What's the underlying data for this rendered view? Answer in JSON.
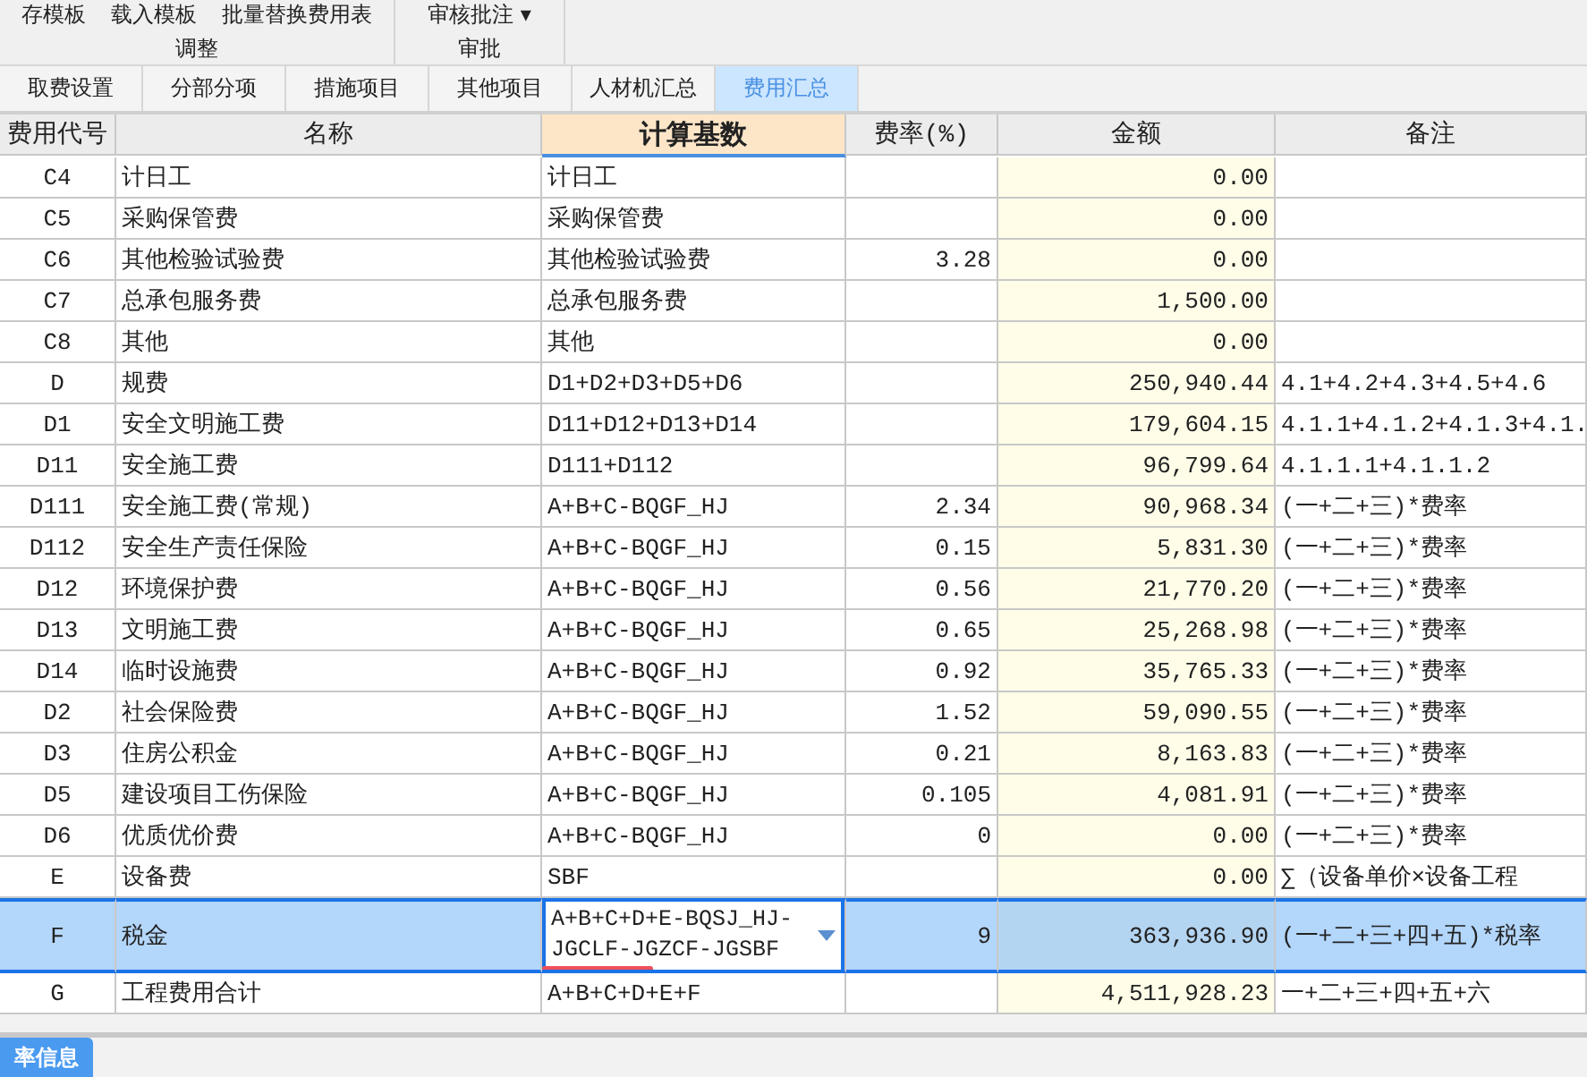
{
  "ribbon": {
    "groups": [
      {
        "label": "调整",
        "buttons": [
          "存模板",
          "载入模板",
          "批量替换费用表"
        ]
      },
      {
        "label": "审批",
        "buttons": [
          "审核批注 ▾"
        ]
      }
    ]
  },
  "tabs": [
    {
      "label": "取费设置",
      "selected": false
    },
    {
      "label": "分部分项",
      "selected": false
    },
    {
      "label": "措施项目",
      "selected": false
    },
    {
      "label": "其他项目",
      "selected": false
    },
    {
      "label": "人材机汇总",
      "selected": false
    },
    {
      "label": "费用汇总",
      "selected": true
    }
  ],
  "table": {
    "columns": [
      {
        "label": "费用代号",
        "highlighted": false
      },
      {
        "label": "名称",
        "highlighted": false
      },
      {
        "label": "计算基数",
        "highlighted": true
      },
      {
        "label": "费率(%)",
        "highlighted": false
      },
      {
        "label": "金额",
        "highlighted": false
      },
      {
        "label": "备注",
        "highlighted": false
      }
    ],
    "rows": [
      {
        "code": "C4",
        "name": "计日工",
        "base": "计日工",
        "rate": "",
        "amount": "0.00",
        "note": "",
        "selected": false
      },
      {
        "code": "C5",
        "name": "采购保管费",
        "base": "采购保管费",
        "rate": "",
        "amount": "0.00",
        "note": "",
        "selected": false
      },
      {
        "code": "C6",
        "name": "其他检验试验费",
        "base": "其他检验试验费",
        "rate": "3.28",
        "amount": "0.00",
        "note": "",
        "selected": false
      },
      {
        "code": "C7",
        "name": "总承包服务费",
        "base": "总承包服务费",
        "rate": "",
        "amount": "1,500.00",
        "note": "",
        "selected": false
      },
      {
        "code": "C8",
        "name": "其他",
        "base": "其他",
        "rate": "",
        "amount": "0.00",
        "note": "",
        "selected": false
      },
      {
        "code": "D",
        "name": "规费",
        "base": "D1+D2+D3+D5+D6",
        "rate": "",
        "amount": "250,940.44",
        "note": "4.1+4.2+4.3+4.5+4.6",
        "selected": false
      },
      {
        "code": "D1",
        "name": "安全文明施工费",
        "base": "D11+D12+D13+D14",
        "rate": "",
        "amount": "179,604.15",
        "note": "4.1.1+4.1.2+4.1.3+4.1.",
        "selected": false
      },
      {
        "code": "D11",
        "name": "安全施工费",
        "base": "D111+D112",
        "rate": "",
        "amount": "96,799.64",
        "note": "4.1.1.1+4.1.1.2",
        "selected": false
      },
      {
        "code": "D111",
        "name": "安全施工费(常规)",
        "base": "A+B+C-BQGF_HJ",
        "rate": "2.34",
        "amount": "90,968.34",
        "note": "(一+二+三)*费率",
        "selected": false
      },
      {
        "code": "D112",
        "name": "安全生产责任保险",
        "base": "A+B+C-BQGF_HJ",
        "rate": "0.15",
        "amount": "5,831.30",
        "note": "(一+二+三)*费率",
        "selected": false
      },
      {
        "code": "D12",
        "name": "环境保护费",
        "base": "A+B+C-BQGF_HJ",
        "rate": "0.56",
        "amount": "21,770.20",
        "note": "(一+二+三)*费率",
        "selected": false
      },
      {
        "code": "D13",
        "name": "文明施工费",
        "base": "A+B+C-BQGF_HJ",
        "rate": "0.65",
        "amount": "25,268.98",
        "note": "(一+二+三)*费率",
        "selected": false
      },
      {
        "code": "D14",
        "name": "临时设施费",
        "base": "A+B+C-BQGF_HJ",
        "rate": "0.92",
        "amount": "35,765.33",
        "note": "(一+二+三)*费率",
        "selected": false
      },
      {
        "code": "D2",
        "name": "社会保险费",
        "base": "A+B+C-BQGF_HJ",
        "rate": "1.52",
        "amount": "59,090.55",
        "note": "(一+二+三)*费率",
        "selected": false
      },
      {
        "code": "D3",
        "name": "住房公积金",
        "base": "A+B+C-BQGF_HJ",
        "rate": "0.21",
        "amount": "8,163.83",
        "note": "(一+二+三)*费率",
        "selected": false
      },
      {
        "code": "D5",
        "name": "建设项目工伤保险",
        "base": "A+B+C-BQGF_HJ",
        "rate": "0.105",
        "amount": "4,081.91",
        "note": "(一+二+三)*费率",
        "selected": false
      },
      {
        "code": "D6",
        "name": "优质优价费",
        "base": "A+B+C-BQGF_HJ",
        "rate": "0",
        "amount": "0.00",
        "note": "(一+二+三)*费率",
        "selected": false
      },
      {
        "code": "E",
        "name": "设备费",
        "base": "SBF",
        "rate": "",
        "amount": "0.00",
        "note": "∑（设备单价×设备工程",
        "selected": false
      },
      {
        "code": "F",
        "name": "税金",
        "base": "A+B+C+D+E-BQSJ_HJ-JGCLF-JGZCF-JGSBF",
        "rate": "9",
        "amount": "363,936.90",
        "note": "(一+二+三+四+五)*税率",
        "selected": true,
        "underlined": true
      },
      {
        "code": "G",
        "name": "工程费用合计",
        "base": "A+B+C+D+E+F",
        "rate": "",
        "amount": "4,511,928.23",
        "note": "一+二+三+四+五+六",
        "selected": false
      }
    ]
  },
  "bottom_button": "率信息"
}
